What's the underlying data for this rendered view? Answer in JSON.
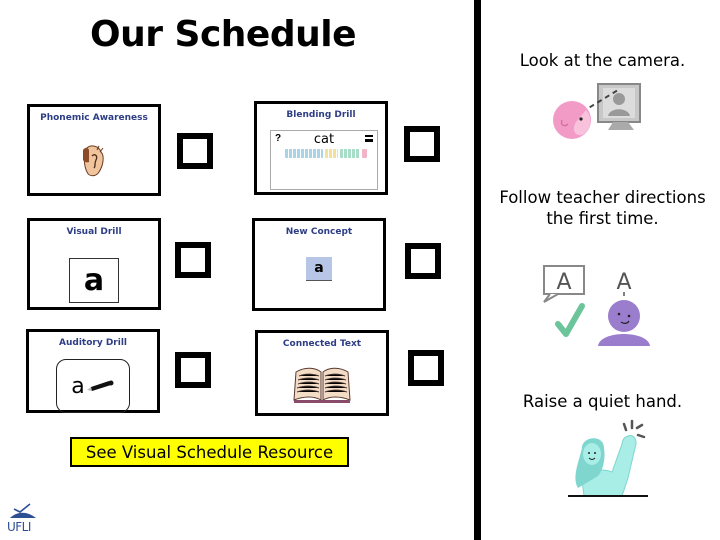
{
  "page": {
    "title": "Our Schedule"
  },
  "schedule": {
    "items": [
      {
        "label": "Phonemic Awareness",
        "icon": "ear-hand-icon",
        "checked": false
      },
      {
        "label": "Blending Drill",
        "icon": "blending-board-icon",
        "checked": false,
        "screen": {
          "question_mark": "?",
          "word": "cat"
        }
      },
      {
        "label": "Visual Drill",
        "icon": "letter-card-icon",
        "checked": false,
        "letter": "a"
      },
      {
        "label": "New Concept",
        "icon": "letter-tile-icon",
        "checked": false,
        "letter": "a"
      },
      {
        "label": "Auditory Drill",
        "icon": "writing-pencil-icon",
        "checked": false,
        "letter": "a"
      },
      {
        "label": "Connected Text",
        "icon": "open-book-icon",
        "checked": false
      }
    ],
    "resource_button": "See Visual Schedule Resource"
  },
  "rules": [
    {
      "text": "Look at the camera.",
      "icon": "look-at-camera-icon"
    },
    {
      "text": "Follow teacher directions the first time.",
      "icon": "follow-directions-icon",
      "speech_letter": "A",
      "echo_letter": "A"
    },
    {
      "text": "Raise a quiet hand.",
      "icon": "raise-hand-icon"
    }
  ],
  "logo": {
    "text": "UFLI"
  },
  "colors": {
    "card_label": "#2e3e85",
    "button_bg": "#ffff00",
    "face_pink": "#f29bc7",
    "child_purple": "#9a7dcc",
    "check_green": "#6cc49a",
    "teal_figure": "#7fd6cf"
  }
}
